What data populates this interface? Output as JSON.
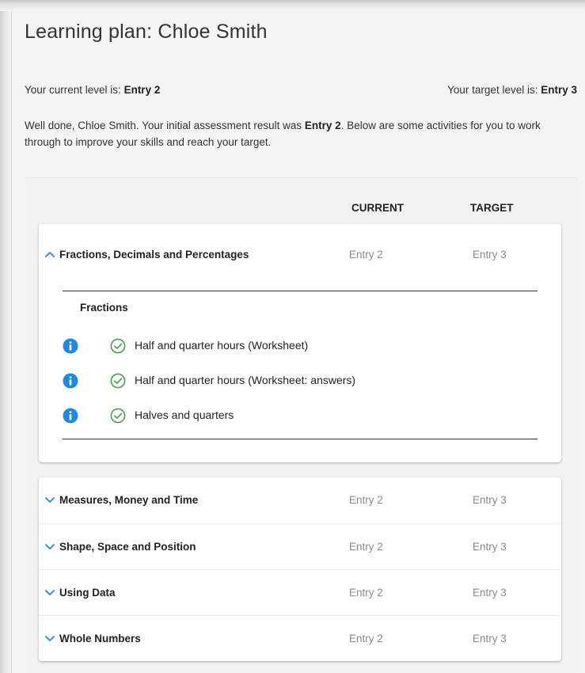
{
  "page": {
    "title": "Learning plan: Chloe Smith",
    "current_level_prefix": "Your current level is: ",
    "current_level_value": "Entry 2",
    "target_level_prefix": "Your target level is: ",
    "target_level_value": "Entry 3",
    "intro_part1": "Well done, Chloe Smith. Your initial assessment result was ",
    "intro_bold": "Entry 2",
    "intro_part2": ". Below are some activities for you to work through to improve your skills and reach your target."
  },
  "table": {
    "col_current": "CURRENT",
    "col_target": "TARGET"
  },
  "expanded": {
    "topic": "Fractions, Decimals and Percentages",
    "current": "Entry 2",
    "target": "Entry 3",
    "subsection_title": "Fractions",
    "activities": [
      {
        "label": "Half and quarter hours (Worksheet)",
        "status": "completed"
      },
      {
        "label": "Half and quarter hours (Worksheet: answers)",
        "status": "completed"
      },
      {
        "label": "Halves and quarters",
        "status": "completed"
      }
    ]
  },
  "topics": [
    {
      "label": "Measures, Money and Time",
      "current": "Entry 2",
      "target": "Entry 3"
    },
    {
      "label": "Shape, Space and Position",
      "current": "Entry 2",
      "target": "Entry 3"
    },
    {
      "label": "Using Data",
      "current": "Entry 2",
      "target": "Entry 3"
    },
    {
      "label": "Whole Numbers",
      "current": "Entry 2",
      "target": "Entry 3"
    }
  ],
  "icons": {
    "expand": "chevron-down-icon",
    "collapse": "chevron-up-icon",
    "info": "info-icon",
    "check": "check-circle-icon"
  },
  "colors": {
    "accent": "#1e88e5",
    "check": "#43a047",
    "muted_text": "#8a8a8a",
    "background": "#f4f4f4"
  }
}
